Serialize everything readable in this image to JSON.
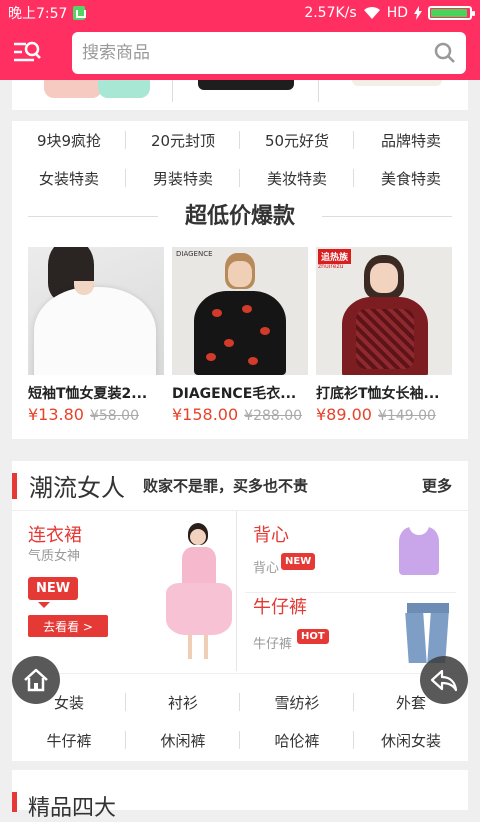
{
  "status_bar": {
    "time": "晚上7:57",
    "speed": "2.57K/s",
    "network": "HD",
    "battery_percent": 95
  },
  "header": {
    "search_placeholder": "搜索商品",
    "icons": [
      "menu-search-icon",
      "search-icon"
    ]
  },
  "categories_row1": [
    "9块9疯抢",
    "20元封顶",
    "50元好货",
    "品牌特卖"
  ],
  "categories_row2": [
    "女装特卖",
    "男装特卖",
    "美妆特卖",
    "美食特卖"
  ],
  "hot_section": {
    "title": "超低价爆款",
    "products": [
      {
        "name": "短袖T恤女夏装2...",
        "price": "¥13.80",
        "old_price": "¥58.00"
      },
      {
        "name": "DIAGENCE毛衣...",
        "price": "¥158.00",
        "old_price": "¥288.00",
        "brand": "DIAGENCE"
      },
      {
        "name": "打底衫T恤女长袖...",
        "price": "¥89.00",
        "old_price": "¥149.00",
        "badge": "追热族",
        "badge_sub": "zhuirezu"
      }
    ]
  },
  "trend_section": {
    "title": "潮流女人",
    "subtitle": "败家不是罪，买多也不贵",
    "more": "更多",
    "left": {
      "title": "连衣裙",
      "subtitle": "气质女神",
      "tag": "NEW",
      "button": "去看看 >"
    },
    "right_top": {
      "title": "背心",
      "subtitle": "背心",
      "tag": "NEW"
    },
    "right_bottom": {
      "title": "牛仔裤",
      "subtitle": "牛仔裤",
      "tag": "HOT"
    }
  },
  "bottom_categories_row1": [
    "女装",
    "衬衫",
    "雪纺衫",
    "外套"
  ],
  "bottom_categories_row2": [
    "牛仔裤",
    "休闲裤",
    "哈伦裤",
    "休闲女装"
  ],
  "next_section_partial": "精品四大",
  "colors": {
    "brand": "#ff2f62",
    "price": "#e8432a",
    "accent": "#e53935"
  }
}
